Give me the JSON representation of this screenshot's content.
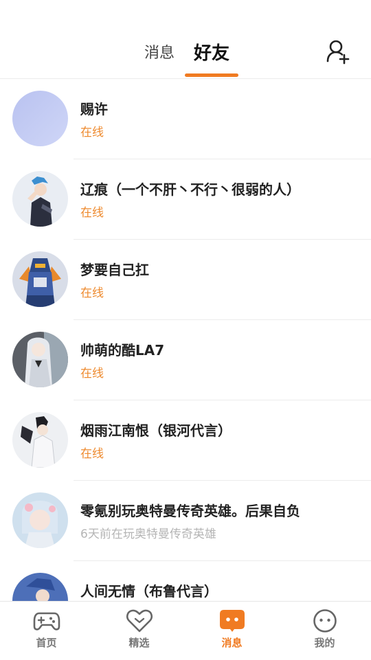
{
  "header": {
    "tab_messages": "消息",
    "tab_friends": "好友",
    "add_friend_icon": "add-user-icon"
  },
  "friends": [
    {
      "name": "赐许",
      "status": "在线",
      "online": true
    },
    {
      "name": "辽痕（一个不肝丶不行丶很弱的人）",
      "status": "在线",
      "online": true
    },
    {
      "name": "梦要自己扛",
      "status": "在线",
      "online": true
    },
    {
      "name": "帅萌的酷LA7",
      "status": "在线",
      "online": true
    },
    {
      "name": "烟雨江南恨（银河代言）",
      "status": "在线",
      "online": true
    },
    {
      "name": "零氪别玩奥特曼传奇英雄。后果自负",
      "status": "6天前在玩奥特曼传奇英雄",
      "online": false
    },
    {
      "name": "人间无情（布鲁代言）",
      "status": "",
      "online": false
    }
  ],
  "tabbar": {
    "items": [
      {
        "label": "首页",
        "icon": "gamepad-icon"
      },
      {
        "label": "精选",
        "icon": "heart-icon"
      },
      {
        "label": "消息",
        "icon": "message-icon",
        "active": true
      },
      {
        "label": "我的",
        "icon": "face-icon"
      }
    ]
  },
  "colors": {
    "accent": "#f07b22",
    "online": "#ee8a2e",
    "offline": "#b5b5b5"
  }
}
